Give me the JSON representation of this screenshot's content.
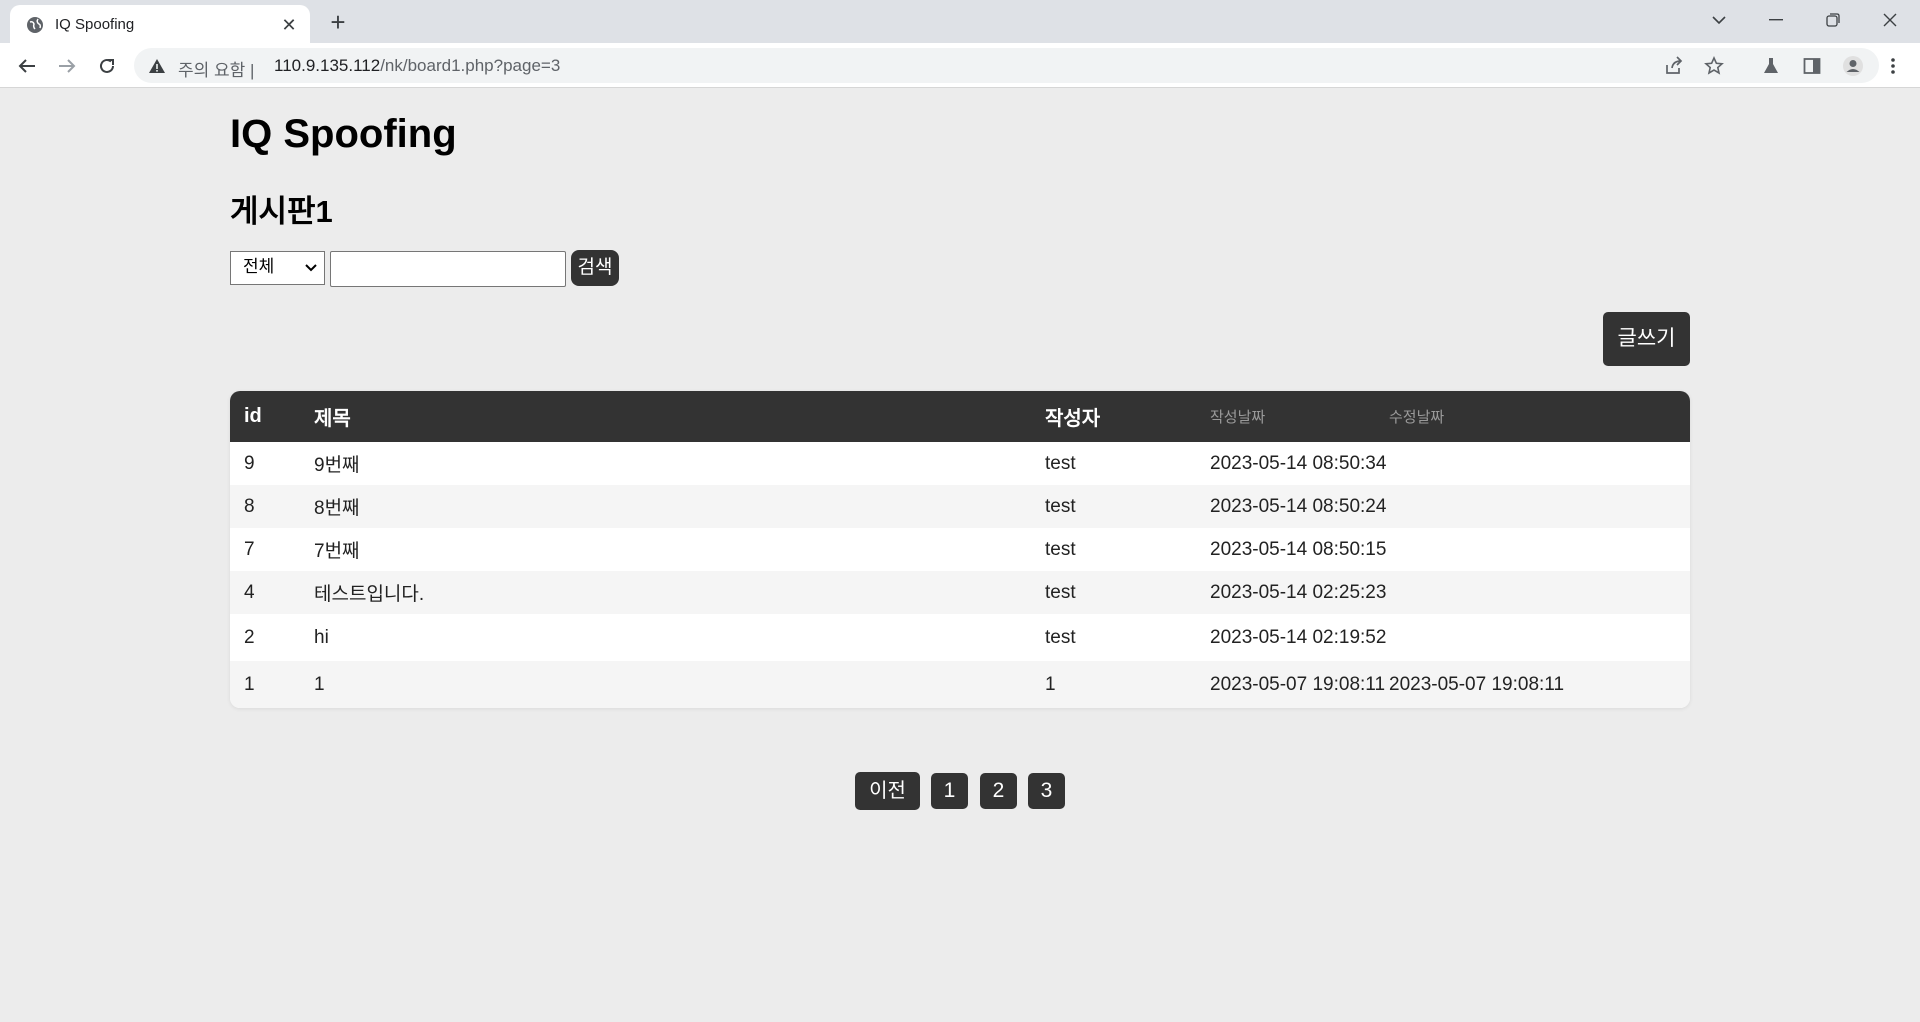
{
  "browser": {
    "tab_title": "IQ Spoofing",
    "url_warning": "주의 요함",
    "url_separator": "|",
    "url_host": "110.9.135.112",
    "url_path": "/nk/board1.php?page=3"
  },
  "page": {
    "site_title": "IQ Spoofing",
    "board_title": "게시판1",
    "search": {
      "select_value": "전체",
      "input_value": "",
      "button_label": "검색"
    },
    "write_button": "글쓰기",
    "columns": [
      "id",
      "제목",
      "작성자",
      "작성날짜",
      "수정날짜"
    ],
    "rows": [
      {
        "id": "9",
        "title": "9번째",
        "author": "test",
        "created": "2023-05-14 08:50:34",
        "modified": ""
      },
      {
        "id": "8",
        "title": "8번째",
        "author": "test",
        "created": "2023-05-14 08:50:24",
        "modified": ""
      },
      {
        "id": "7",
        "title": "7번째",
        "author": "test",
        "created": "2023-05-14 08:50:15",
        "modified": ""
      },
      {
        "id": "4",
        "title": "테스트입니다.",
        "author": "test",
        "created": "2023-05-14 02:25:23",
        "modified": ""
      },
      {
        "id": "2",
        "title": "hi",
        "author": "test",
        "created": "2023-05-14 02:19:52",
        "modified": ""
      },
      {
        "id": "1",
        "title": "1",
        "author": "1",
        "created": "2023-05-07 19:08:11",
        "modified": "2023-05-07 19:08:11"
      }
    ],
    "pagination": {
      "prev_label": "이전",
      "pages": [
        "1",
        "2",
        "3"
      ]
    }
  },
  "colors": {
    "header_bg": "#333333",
    "page_bg": "#ececec",
    "row_alt_bg": "#f5f5f5"
  }
}
